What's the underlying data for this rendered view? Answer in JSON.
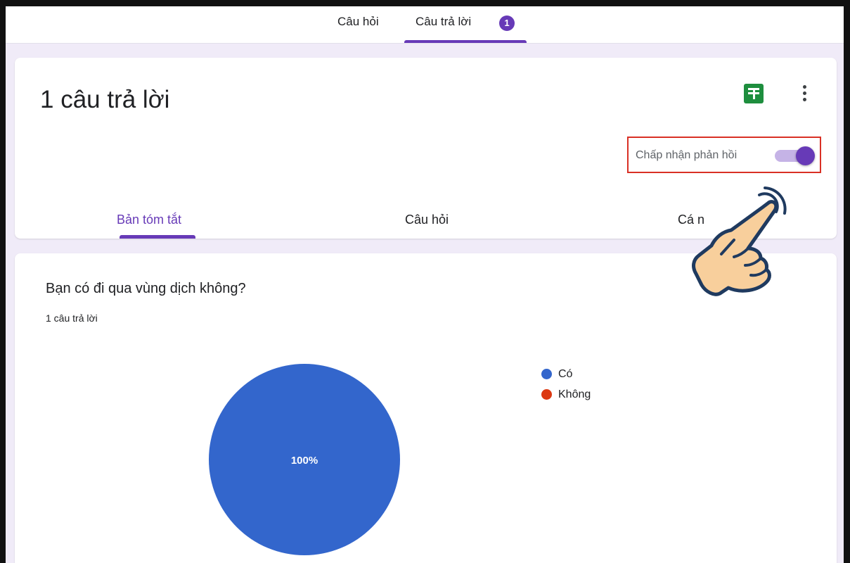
{
  "top_tabs": {
    "questions_label": "Câu hỏi",
    "responses_label": "Câu trả lời",
    "responses_badge": "1"
  },
  "summary_card": {
    "title": "1 câu trả lời",
    "accept_label": "Chấp nhận phản hồi",
    "accept_on": true,
    "sub_tabs": [
      "Bản tóm tắt",
      "Câu hỏi",
      "Cá n"
    ]
  },
  "question_card": {
    "title": "Bạn có đi qua vùng dịch không?",
    "count": "1 câu trả lời"
  },
  "colors": {
    "accent": "#673ab7",
    "sheets_green": "#1e8e3e",
    "highlight_box": "#d93025"
  },
  "chart_data": {
    "type": "pie",
    "categories": [
      "Có",
      "Không"
    ],
    "values": [
      100,
      0
    ],
    "colors": [
      "#3366cc",
      "#dc3912"
    ],
    "slice_labels": [
      "100%"
    ],
    "legend_position": "right"
  }
}
